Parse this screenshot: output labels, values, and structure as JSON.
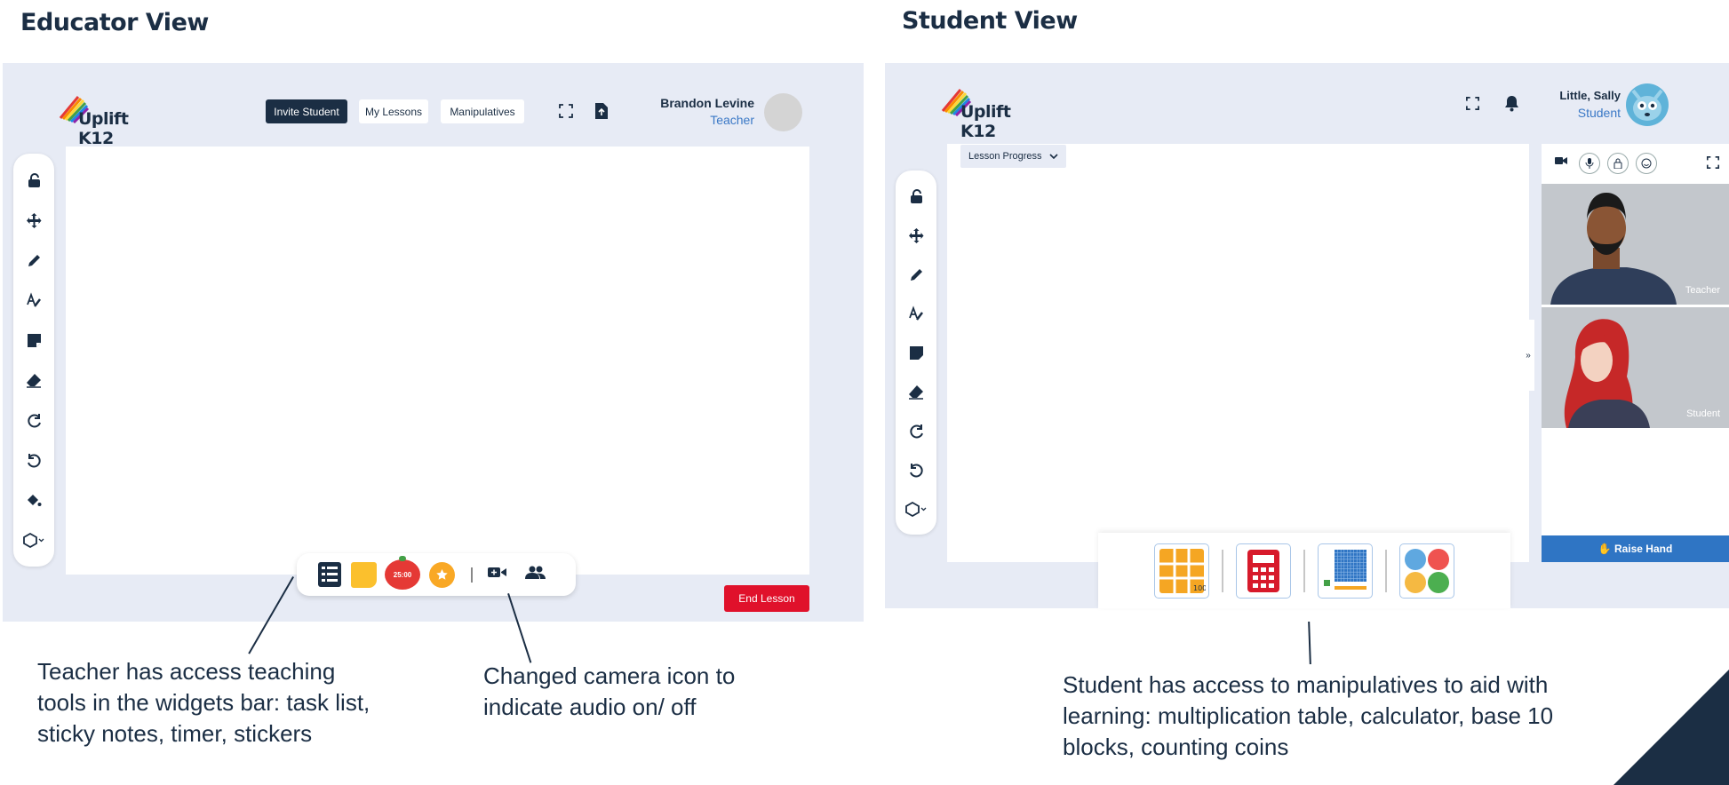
{
  "educator": {
    "heading": "Educator View",
    "logo": "Uplift K12",
    "buttons": {
      "invite": "Invite Student",
      "lessons": "My Lessons",
      "manipulatives": "Manipulatives"
    },
    "user": {
      "name": "Brandon Levine",
      "role": "Teacher"
    },
    "end_lesson": "End Lesson",
    "timer_label": "25:00",
    "tools": [
      "unlock-icon",
      "move-icon",
      "pencil-icon",
      "highlighter-icon",
      "sticky-note-icon",
      "eraser-icon",
      "redo-icon",
      "undo-icon",
      "fill-icon",
      "shapes-icon"
    ],
    "widgets": [
      "task-list-icon",
      "sticky-notes-icon",
      "timer-icon",
      "sticker-icon",
      "camera-icon",
      "participants-icon"
    ]
  },
  "student": {
    "heading": "Student View",
    "logo": "Uplift K12",
    "user": {
      "name": "Little, Sally",
      "role": "Student"
    },
    "lesson_progress": "Lesson Progress",
    "video": {
      "teacher_label": "Teacher",
      "student_label": "Student"
    },
    "raise_hand": "✋ Raise Hand",
    "manipulatives": [
      "multiplication-table-icon",
      "calculator-icon",
      "base-10-blocks-icon",
      "counting-coins-icon"
    ]
  },
  "annotations": {
    "teacher_tools": "Teacher has access teaching tools in the widgets bar: task list, sticky notes, timer, stickers",
    "camera": "Changed camera icon to indicate audio on/ off",
    "student_manip": "Student has access to manipulatives  to aid with learning: multiplication table, calculator, base 10 blocks, counting coins"
  },
  "colors": {
    "navy": "#1b2e44",
    "panel": "#e7ebf5",
    "accent_blue": "#3a78c6",
    "end_red": "#e0112b",
    "raise_hand_blue": "#2f75c4"
  }
}
